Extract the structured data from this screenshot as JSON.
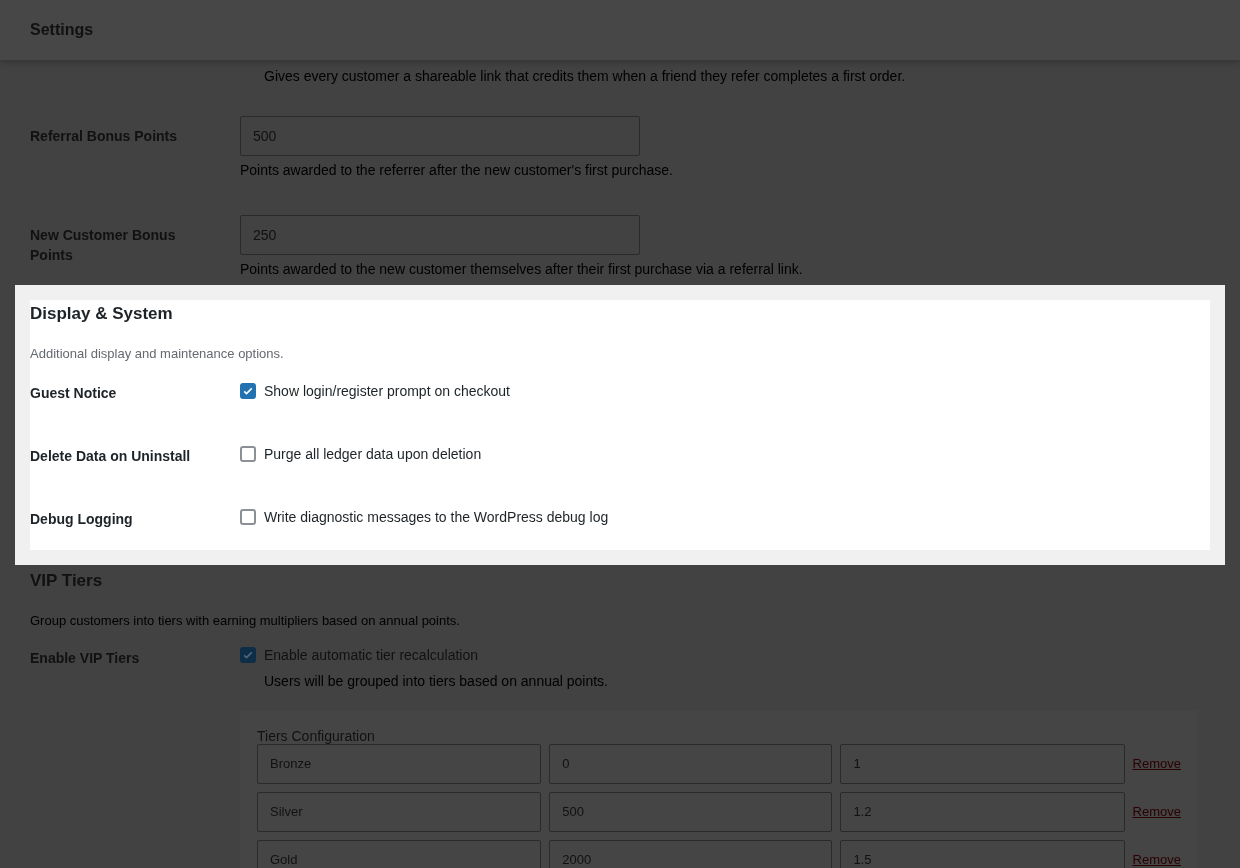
{
  "header": {
    "title": "Settings"
  },
  "referrals": {
    "description": "Gives every customer a shareable link that credits them when a friend they refer completes a first order.",
    "fields": [
      {
        "label": "Referral Bonus Points",
        "value": "500",
        "description": "Points awarded to the referrer after the new customer's first purchase."
      },
      {
        "label": "New Customer Bonus Points",
        "value": "250",
        "description": "Points awarded to the new customer themselves after their first purchase via a referral link."
      }
    ]
  },
  "display_system": {
    "title": "Display & System",
    "description": "Additional display and maintenance options.",
    "options": [
      {
        "label": "Guest Notice",
        "text": "Show login/register prompt on checkout",
        "checked": true
      },
      {
        "label": "Delete Data on Uninstall",
        "text": "Purge all ledger data upon deletion",
        "checked": false
      },
      {
        "label": "Debug Logging",
        "text": "Write diagnostic messages to the WordPress debug log",
        "checked": false
      }
    ]
  },
  "vip_tiers": {
    "title": "VIP Tiers",
    "description": "Group customers into tiers with earning multipliers based on annual points.",
    "enable": {
      "label": "Enable VIP Tiers",
      "text": "Enable automatic tier recalculation",
      "checked": true,
      "description": "Users will be grouped into tiers based on annual points."
    },
    "tiers_config": {
      "title": "Tiers Configuration",
      "rows": [
        {
          "name": "Bronze",
          "points": "0",
          "multiplier": "1",
          "remove": "Remove"
        },
        {
          "name": "Silver",
          "points": "500",
          "multiplier": "1.2",
          "remove": "Remove"
        },
        {
          "name": "Gold",
          "points": "2000",
          "multiplier": "1.5",
          "remove": "Remove"
        }
      ]
    }
  }
}
